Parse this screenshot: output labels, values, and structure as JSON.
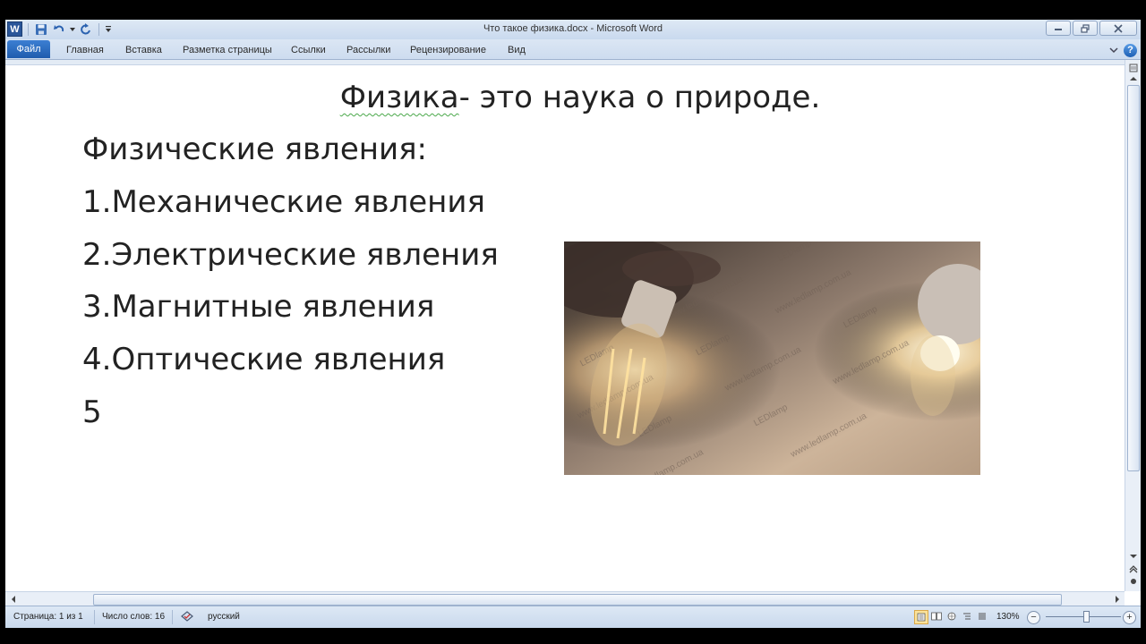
{
  "window": {
    "title": "Что такое физика.docx  -  Microsoft Word"
  },
  "quick_access": {
    "logo_letter": "W",
    "icons": [
      "word-logo-icon",
      "save-icon",
      "undo-icon",
      "redo-icon",
      "customize-icon"
    ]
  },
  "ribbon": {
    "tabs": [
      {
        "label": "Файл",
        "active": true
      },
      {
        "label": "Главная"
      },
      {
        "label": "Вставка"
      },
      {
        "label": "Разметка страницы"
      },
      {
        "label": "Ссылки"
      },
      {
        "label": "Рассылки"
      },
      {
        "label": "Рецензирование"
      },
      {
        "label": "Вид"
      }
    ],
    "help_label": "?"
  },
  "document": {
    "title_part1": "Физика",
    "title_part2": "- это наука о природе.",
    "heading": "Физические явления:",
    "items": [
      "1.Механические явления",
      "2.Электрические явления",
      "3.Магнитные явления",
      "4.Оптические явления",
      "5"
    ],
    "image_watermark": "LEDlamp",
    "image_url_text": "www.ledlamp.com.ua"
  },
  "statusbar": {
    "page": "Страница: 1 из 1",
    "words": "Число слов: 16",
    "language": "русский",
    "zoom": "130%",
    "zoom_minus": "−",
    "zoom_plus": "+"
  },
  "colors": {
    "file_tab": "#1f5cad",
    "title_bar": "#dfe9f5",
    "status_bar": "#c8d8ec",
    "text": "#222222"
  }
}
